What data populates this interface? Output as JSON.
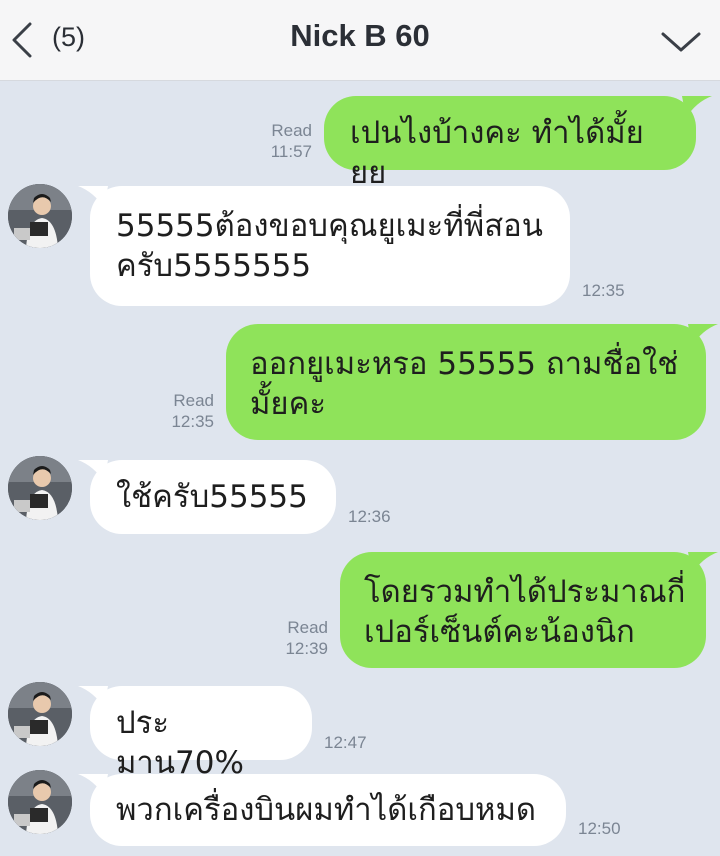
{
  "header": {
    "back_label": "(5)",
    "title": "Nick B 60",
    "back_icon": "chevron-left-icon",
    "menu_icon": "chevron-down-icon"
  },
  "colors": {
    "background": "#dfe5ee",
    "outgoing_bubble": "#8fe35a",
    "incoming_bubble": "#ffffff",
    "meta_text": "#7b8593"
  },
  "messages": [
    {
      "direction": "out",
      "text": "เปนไงบ้างคะ ทำได้มั้ยยย",
      "read": "Read",
      "time": "11:57"
    },
    {
      "direction": "in",
      "text": "55555ต้องขอบคุณยูเมะที่พี่สอน\nครับ5555555",
      "time": "12:35"
    },
    {
      "direction": "out",
      "text": "ออกยูเมะหรอ 55555 ถามชื่อใช่\nมั้ยคะ",
      "read": "Read",
      "time": "12:35"
    },
    {
      "direction": "in",
      "text": "ใช้ครับ55555",
      "time": "12:36"
    },
    {
      "direction": "out",
      "text": "โดยรวมทำได้ประมาณกี่\nเปอร์เซ็นต์คะน้องนิก",
      "read": "Read",
      "time": "12:39"
    },
    {
      "direction": "in",
      "text": "ประมาน70%",
      "time": "12:47"
    },
    {
      "direction": "in",
      "text": "พวกเครื่องบินผมทำได้เกือบหมด",
      "time": "12:50"
    }
  ]
}
